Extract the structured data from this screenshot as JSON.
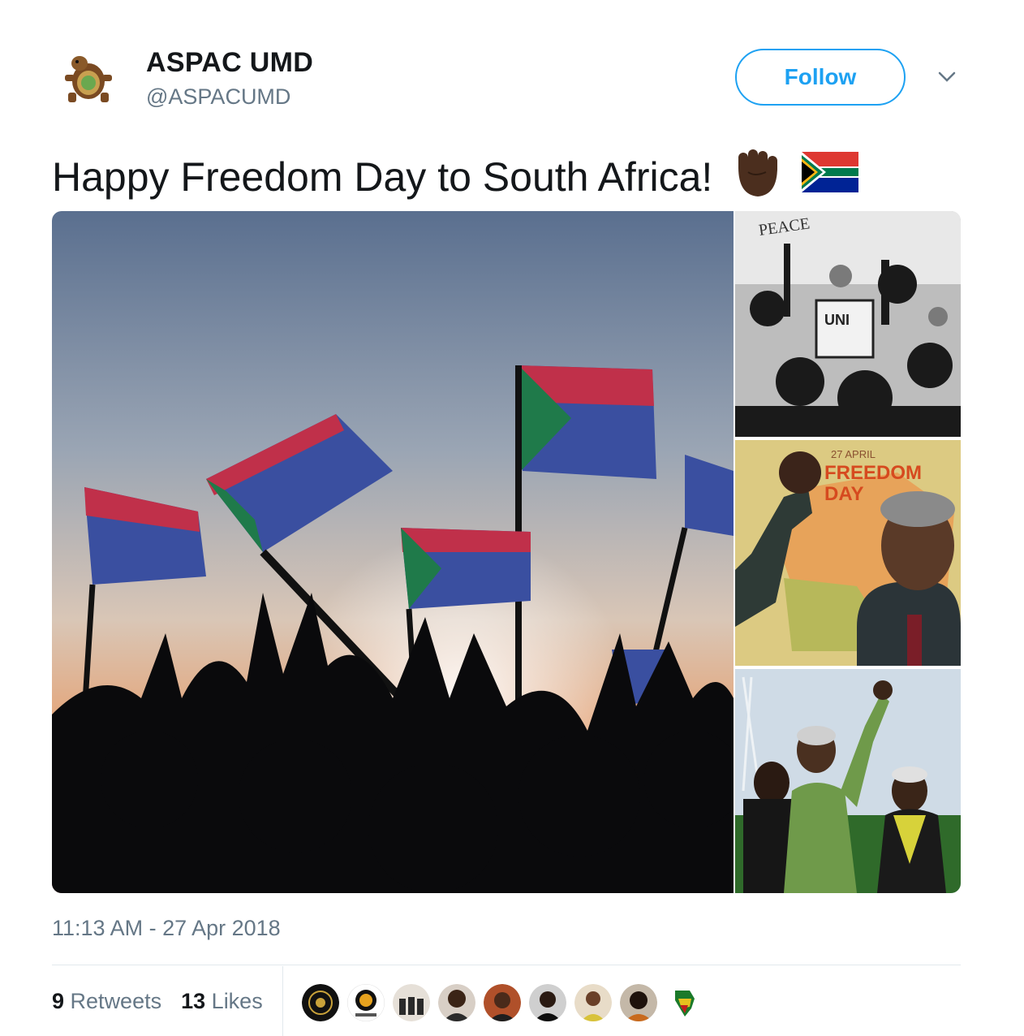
{
  "user": {
    "name": "ASPAC UMD",
    "handle": "@ASPACUMD",
    "avatar_icon": "turtle-logo-icon"
  },
  "follow_button": {
    "label": "Follow"
  },
  "menu": {
    "icon": "chevron-down-icon"
  },
  "tweet": {
    "text": "Happy Freedom Day to South Africa!",
    "emojis": [
      "raised-fist-icon",
      "south-africa-flag-icon"
    ]
  },
  "media": {
    "main": "flags-crowd-silhouette-photo",
    "side": [
      "protest-crowd-bw-photo",
      "freedom-day-poster",
      "mandela-raised-fist-photo"
    ],
    "poster_text": {
      "date": "27 APRIL",
      "line1": "FREEDOM",
      "line2": "DAY"
    }
  },
  "timestamp": "11:13 AM - 27 Apr 2018",
  "stats": {
    "retweets_count": "9",
    "retweets_label": "Retweets",
    "likes_count": "13",
    "likes_label": "Likes"
  },
  "likers": [
    "liker-avatar-1",
    "liker-avatar-2",
    "liker-avatar-3",
    "liker-avatar-4",
    "liker-avatar-5",
    "liker-avatar-6",
    "liker-avatar-7",
    "liker-avatar-8",
    "liker-avatar-9"
  ],
  "colors": {
    "accent": "#1da1f2",
    "text": "#14171a",
    "secondary": "#657786",
    "border": "#e1e8ed"
  }
}
